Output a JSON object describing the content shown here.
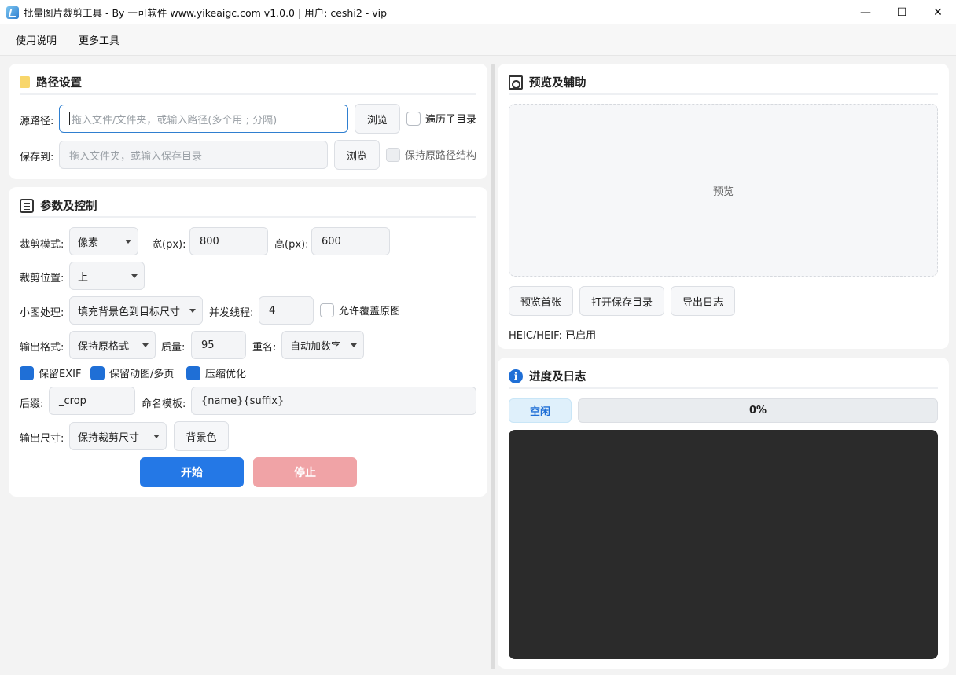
{
  "window": {
    "title": "批量图片裁剪工具 - By 一可软件 www.yikeaigc.com  v1.0.0  |  用户: ceshi2 - vip",
    "minimize": "—",
    "maximize": "☐",
    "close": "✕"
  },
  "menu": [
    "使用说明",
    "更多工具"
  ],
  "path_section": {
    "title": "路径设置",
    "source_label": "源路径:",
    "source_placeholder": "拖入文件/文件夹，或输入路径(多个用 ; 分隔)",
    "browse": "浏览",
    "recurse_label": "遍历子目录",
    "recurse_checked": false,
    "save_label": "保存到:",
    "save_placeholder": "拖入文件夹，或输入保存目录",
    "keep_structure_label": "保持原路径结构",
    "keep_structure_checked": false
  },
  "params_section": {
    "title": "参数及控制",
    "crop_mode_label": "裁剪模式:",
    "crop_mode": "像素",
    "width_label": "宽(px):",
    "width": "800",
    "height_label": "高(px):",
    "height": "600",
    "crop_pos_label": "裁剪位置:",
    "crop_pos": "上",
    "small_label": "小图处理:",
    "small_mode": "填充背景色到目标尺寸",
    "threads_label": "并发线程:",
    "threads": "4",
    "overwrite_label": "允许覆盖原图",
    "overwrite_checked": false,
    "format_label": "输出格式:",
    "format": "保持原格式",
    "quality_label": "质量:",
    "quality": "95",
    "rename_label": "重名:",
    "rename": "自动加数字",
    "keep_exif": "保留EXIF",
    "keep_anim": "保留动图/多页",
    "compress": "压缩优化",
    "keep_exif_checked": true,
    "keep_anim_checked": true,
    "compress_checked": true,
    "suffix_label": "后缀:",
    "suffix": "_crop",
    "template_label": "命名模板:",
    "template": "{name}{suffix}",
    "size_label": "输出尺寸:",
    "size_mode": "保持裁剪尺寸",
    "bg_color": "背景色",
    "start": "开始",
    "stop": "停止"
  },
  "preview_section": {
    "title": "预览及辅助",
    "placeholder": "预览",
    "preview_first": "预览首张",
    "open_dir": "打开保存目录",
    "export_log": "导出日志",
    "heic": "HEIC/HEIF: 已启用"
  },
  "progress_section": {
    "title": "进度及日志",
    "status": "空闲",
    "percent_text": "0%",
    "percent": 0
  },
  "colors": {
    "accent": "#2478e6",
    "stop": "#f0a3a6",
    "log_bg": "#2b2b2b"
  }
}
